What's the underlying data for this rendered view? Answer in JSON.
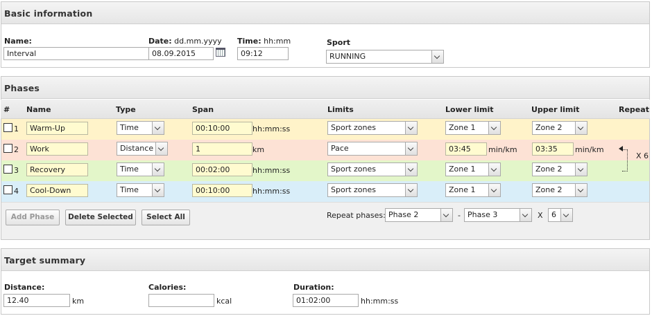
{
  "basic": {
    "header": "Basic information",
    "name_label": "Name:",
    "name_value": "Interval",
    "date_label": "Date:",
    "date_format": "dd.mm.yyyy",
    "date_value": "08.09.2015",
    "time_label": "Time:",
    "time_format": "hh:mm",
    "time_value": "09:12",
    "sport_label": "Sport",
    "sport_value": "RUNNING"
  },
  "phases": {
    "header": "Phases",
    "columns": {
      "num": "#",
      "name": "Name",
      "type": "Type",
      "span": "Span",
      "limits": "Limits",
      "lower": "Lower limit",
      "upper": "Upper limit",
      "repeat": "Repeat"
    },
    "rows": [
      {
        "num": "1",
        "name": "Warm-Up",
        "type": "Time",
        "span": "00:10:00",
        "span_unit": "hh:mm:ss",
        "limits": "Sport zones",
        "lower": "Zone 1",
        "upper": "Zone 2"
      },
      {
        "num": "2",
        "name": "Work",
        "type": "Distance",
        "span": "1",
        "span_unit": "km",
        "limits": "Pace",
        "lower": "03:45",
        "lower_unit": "min/km",
        "upper": "03:35",
        "upper_unit": "min/km"
      },
      {
        "num": "3",
        "name": "Recovery",
        "type": "Time",
        "span": "00:02:00",
        "span_unit": "hh:mm:ss",
        "limits": "Sport zones",
        "lower": "Zone 1",
        "upper": "Zone 2"
      },
      {
        "num": "4",
        "name": "Cool-Down",
        "type": "Time",
        "span": "00:10:00",
        "span_unit": "hh:mm:ss",
        "limits": "Sport zones",
        "lower": "Zone 1",
        "upper": "Zone 2"
      }
    ],
    "repeat_marker": "X 6",
    "buttons": {
      "add": "Add Phase",
      "delete": "Delete Selected",
      "select_all": "Select All"
    },
    "repeat_label": "Repeat phases:",
    "repeat_from": "Phase 2",
    "repeat_dash": "-",
    "repeat_to": "Phase 3",
    "repeat_x": "X",
    "repeat_count": "6"
  },
  "summary": {
    "header": "Target summary",
    "distance_label": "Distance:",
    "distance_value": "12.40",
    "distance_unit": "km",
    "calories_label": "Calories:",
    "calories_value": "",
    "calories_unit": "kcal",
    "duration_label": "Duration:",
    "duration_value": "01:02:00",
    "duration_unit": "hh:mm:ss"
  }
}
